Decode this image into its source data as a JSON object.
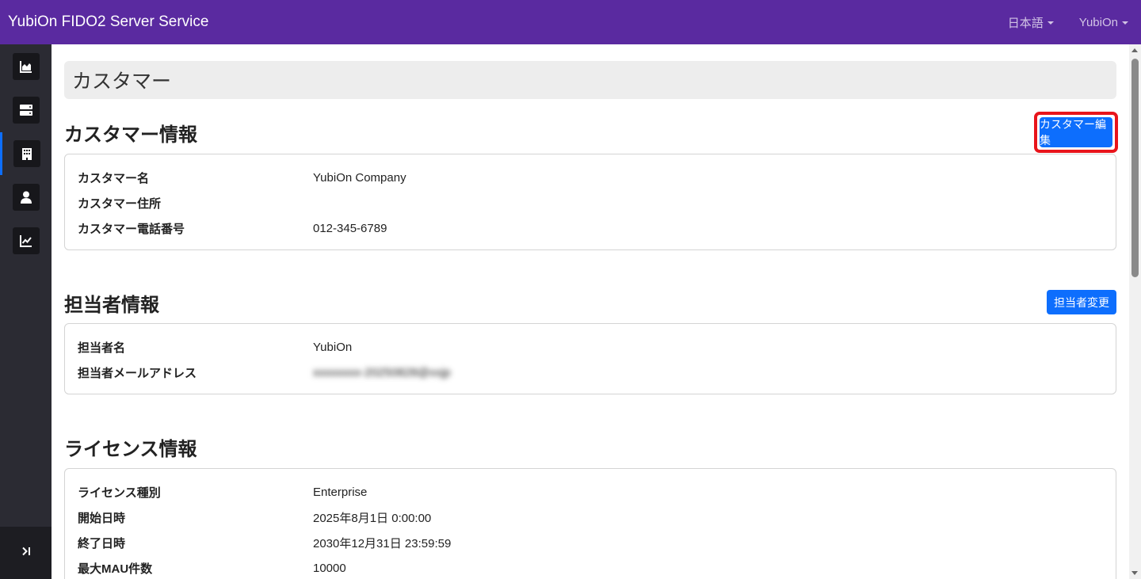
{
  "navbar": {
    "brand": "YubiOn FIDO2 Server Service",
    "language": "日本語",
    "user": "YubiOn"
  },
  "sidebar": {
    "items": [
      {
        "icon": "area-chart-icon"
      },
      {
        "icon": "server-icon"
      },
      {
        "icon": "building-icon",
        "active": true
      },
      {
        "icon": "user-icon"
      },
      {
        "icon": "line-chart-icon"
      }
    ],
    "footer_icon": "collapse-toggle-icon"
  },
  "page": {
    "title": "カスタマー"
  },
  "customer": {
    "heading": "カスタマー情報",
    "edit_button": "カスタマー編集",
    "rows": [
      {
        "label": "カスタマー名",
        "value": "YubiOn Company"
      },
      {
        "label": "カスタマー住所",
        "value": ""
      },
      {
        "label": "カスタマー電話番号",
        "value": "012-345-6789"
      }
    ]
  },
  "contact": {
    "heading": "担当者情報",
    "change_button": "担当者変更",
    "rows": [
      {
        "label": "担当者名",
        "value": "YubiOn"
      },
      {
        "label": "担当者メールアドレス",
        "value": "xxxxxxxx-20250828@xxjp"
      }
    ]
  },
  "license": {
    "heading": "ライセンス情報",
    "rows": [
      {
        "label": "ライセンス種別",
        "value": "Enterprise"
      },
      {
        "label": "開始日時",
        "value": "2025年8月1日 0:00:00"
      },
      {
        "label": "終了日時",
        "value": "2030年12月31日 23:59:59"
      },
      {
        "label": "最大MAU件数",
        "value": "10000"
      }
    ]
  },
  "colors": {
    "navbar": "#5a2aa0",
    "sidebar": "#2b2b33",
    "primary": "#0d6efd",
    "highlight": "#e8141b"
  }
}
